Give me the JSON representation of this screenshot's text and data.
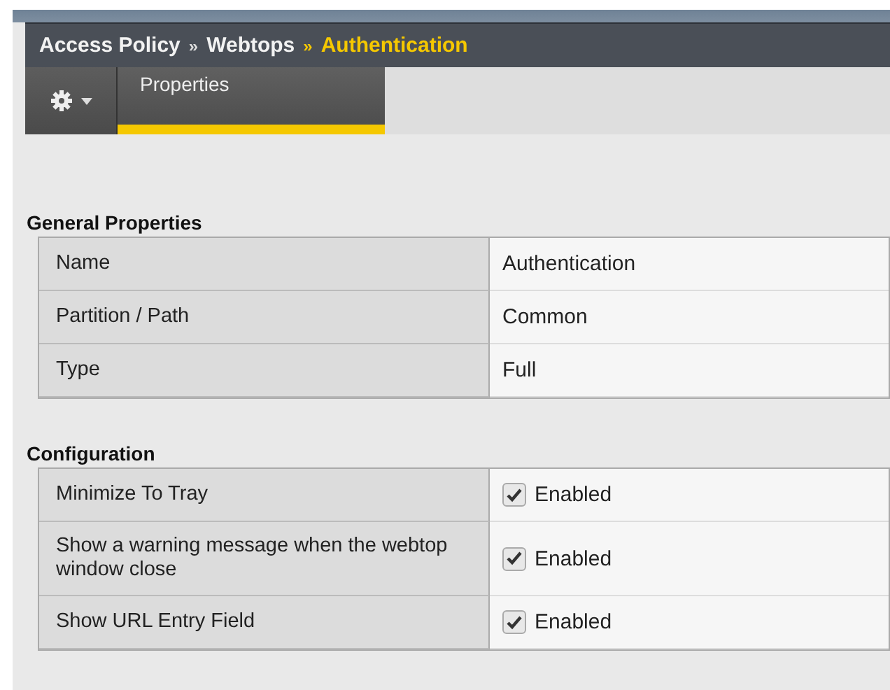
{
  "breadcrumb": [
    {
      "label": "Access Policy",
      "current": false
    },
    {
      "label": "Webtops",
      "current": false
    },
    {
      "label": "Authentication",
      "current": true
    }
  ],
  "breadcrumb_separator": "»",
  "tabs": [
    {
      "label": "Properties",
      "selected": true
    }
  ],
  "sections": [
    {
      "title": "General Properties",
      "rows": [
        {
          "label": "Name",
          "kind": "text",
          "value": "Authentication"
        },
        {
          "label": "Partition / Path",
          "kind": "text",
          "value": "Common"
        },
        {
          "label": "Type",
          "kind": "text",
          "value": "Full"
        }
      ]
    },
    {
      "title": "Configuration",
      "rows": [
        {
          "label": "Minimize To Tray",
          "kind": "checkbox",
          "checked": true,
          "value": "Enabled"
        },
        {
          "label": "Show a warning message when the webtop window close",
          "kind": "checkbox",
          "checked": true,
          "value": "Enabled"
        },
        {
          "label": "Show URL Entry Field",
          "kind": "checkbox",
          "checked": true,
          "value": "Enabled"
        }
      ]
    }
  ]
}
